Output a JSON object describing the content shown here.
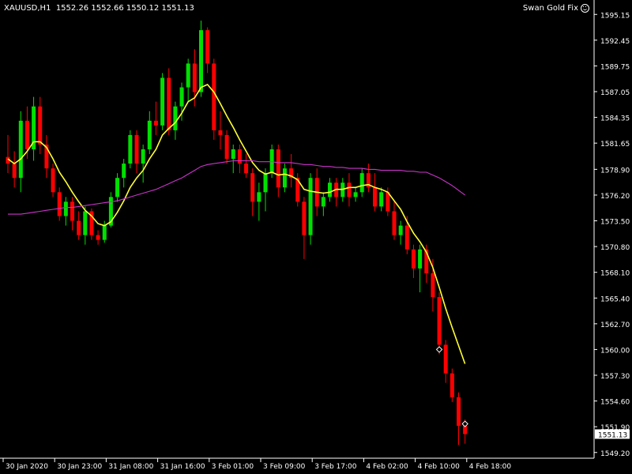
{
  "header": {
    "symbol": "XAUUSD,H1",
    "open": "1552.26",
    "high": "1552.66",
    "low": "1550.12",
    "close": "1551.13"
  },
  "expert": {
    "name": "Swan Gold Fix",
    "icon": "smiley-face-icon"
  },
  "colors": {
    "background": "#000000",
    "bull": "#00e000",
    "bear": "#ff0000",
    "ma_fast": "#ffff33",
    "ma_slow": "#cc33cc",
    "axis": "#ffffff",
    "price_tag_bg": "#ffffff",
    "price_tag_text": "#000000"
  },
  "chart_data": {
    "type": "candlestick",
    "timeframe": "H1",
    "current_price": "1551.13",
    "ylim": [
      1548.6,
      1596.0
    ],
    "y_ticks": [
      "1595.15",
      "1592.45",
      "1589.75",
      "1587.05",
      "1584.35",
      "1581.65",
      "1578.90",
      "1576.20",
      "1573.50",
      "1570.80",
      "1568.10",
      "1565.40",
      "1562.70",
      "1560.00",
      "1557.30",
      "1554.60",
      "1551.90",
      "1549.20"
    ],
    "x_ticks": [
      {
        "index": 0,
        "label": "30 Jan 2020"
      },
      {
        "index": 8,
        "label": "30 Jan 23:00"
      },
      {
        "index": 16,
        "label": "31 Jan 08:00"
      },
      {
        "index": 24,
        "label": "31 Jan 16:00"
      },
      {
        "index": 32,
        "label": "3 Feb 01:00"
      },
      {
        "index": 40,
        "label": "3 Feb 09:00"
      },
      {
        "index": 48,
        "label": "3 Feb 17:00"
      },
      {
        "index": 56,
        "label": "4 Feb 02:00"
      },
      {
        "index": 64,
        "label": "4 Feb 10:00"
      },
      {
        "index": 72,
        "label": "4 Feb 18:00"
      }
    ],
    "candles": [
      [
        1580.2,
        1582.5,
        1578.5,
        1579.5
      ],
      [
        1579.5,
        1580.8,
        1577.0,
        1578.0
      ],
      [
        1578.0,
        1585.0,
        1576.5,
        1584.0
      ],
      [
        1584.0,
        1585.5,
        1580.0,
        1581.0
      ],
      [
        1581.0,
        1586.5,
        1579.8,
        1585.5
      ],
      [
        1585.5,
        1586.5,
        1580.5,
        1581.5
      ],
      [
        1581.5,
        1582.5,
        1578.0,
        1579.0
      ],
      [
        1579.0,
        1579.5,
        1576.0,
        1576.5
      ],
      [
        1576.5,
        1577.0,
        1573.5,
        1574.0
      ],
      [
        1574.0,
        1576.0,
        1573.0,
        1575.5
      ],
      [
        1575.5,
        1576.0,
        1572.5,
        1573.5
      ],
      [
        1573.5,
        1574.5,
        1571.5,
        1572.0
      ],
      [
        1572.0,
        1575.0,
        1571.0,
        1574.5
      ],
      [
        1574.5,
        1574.8,
        1571.5,
        1572.0
      ],
      [
        1572.0,
        1572.5,
        1571.0,
        1571.5
      ],
      [
        1571.5,
        1573.5,
        1571.2,
        1573.0
      ],
      [
        1573.0,
        1576.5,
        1572.8,
        1576.0
      ],
      [
        1576.0,
        1578.5,
        1575.5,
        1578.0
      ],
      [
        1578.0,
        1580.0,
        1577.0,
        1579.5
      ],
      [
        1579.5,
        1583.0,
        1579.0,
        1582.5
      ],
      [
        1582.5,
        1583.0,
        1578.5,
        1579.5
      ],
      [
        1579.5,
        1581.5,
        1577.5,
        1581.0
      ],
      [
        1581.0,
        1585.0,
        1580.5,
        1584.0
      ],
      [
        1584.0,
        1586.0,
        1582.5,
        1583.5
      ],
      [
        1583.5,
        1589.0,
        1583.0,
        1588.5
      ],
      [
        1588.5,
        1589.5,
        1582.5,
        1583.0
      ],
      [
        1583.0,
        1586.0,
        1582.0,
        1585.5
      ],
      [
        1585.5,
        1588.0,
        1584.0,
        1587.5
      ],
      [
        1587.5,
        1590.5,
        1586.0,
        1590.0
      ],
      [
        1590.0,
        1591.5,
        1585.5,
        1587.0
      ],
      [
        1587.0,
        1594.5,
        1586.5,
        1593.5
      ],
      [
        1593.5,
        1593.8,
        1589.0,
        1590.0
      ],
      [
        1590.0,
        1590.5,
        1582.0,
        1583.0
      ],
      [
        1583.0,
        1585.0,
        1581.0,
        1582.5
      ],
      [
        1582.5,
        1583.0,
        1579.5,
        1580.0
      ],
      [
        1580.0,
        1581.5,
        1578.5,
        1581.0
      ],
      [
        1581.0,
        1581.5,
        1578.5,
        1579.5
      ],
      [
        1579.5,
        1580.5,
        1578.0,
        1578.5
      ],
      [
        1578.5,
        1579.0,
        1574.0,
        1575.5
      ],
      [
        1575.5,
        1577.5,
        1573.5,
        1576.5
      ],
      [
        1576.5,
        1579.0,
        1574.5,
        1578.5
      ],
      [
        1578.5,
        1581.5,
        1578.0,
        1581.0
      ],
      [
        1581.0,
        1581.5,
        1576.0,
        1577.0
      ],
      [
        1577.0,
        1579.5,
        1576.5,
        1579.0
      ],
      [
        1579.0,
        1580.5,
        1577.0,
        1578.0
      ],
      [
        1578.0,
        1578.5,
        1575.0,
        1575.5
      ],
      [
        1575.5,
        1576.0,
        1569.5,
        1572.0
      ],
      [
        1572.0,
        1578.5,
        1571.0,
        1578.0
      ],
      [
        1578.0,
        1579.0,
        1574.0,
        1575.0
      ],
      [
        1575.0,
        1576.5,
        1574.0,
        1576.0
      ],
      [
        1576.0,
        1578.0,
        1575.5,
        1577.5
      ],
      [
        1577.5,
        1578.0,
        1575.0,
        1576.0
      ],
      [
        1576.0,
        1578.0,
        1575.5,
        1577.5
      ],
      [
        1577.5,
        1578.5,
        1575.0,
        1576.0
      ],
      [
        1576.0,
        1577.0,
        1575.5,
        1576.5
      ],
      [
        1576.5,
        1579.0,
        1576.0,
        1578.5
      ],
      [
        1578.5,
        1579.5,
        1576.5,
        1577.0
      ],
      [
        1577.0,
        1578.5,
        1574.5,
        1575.0
      ],
      [
        1575.0,
        1577.0,
        1574.5,
        1576.5
      ],
      [
        1576.5,
        1577.0,
        1574.0,
        1574.5
      ],
      [
        1574.5,
        1575.5,
        1571.5,
        1572.0
      ],
      [
        1572.0,
        1573.5,
        1571.0,
        1573.0
      ],
      [
        1573.0,
        1574.0,
        1570.0,
        1570.5
      ],
      [
        1570.5,
        1571.0,
        1567.5,
        1568.5
      ],
      [
        1568.5,
        1571.0,
        1566.0,
        1570.5
      ],
      [
        1570.5,
        1571.0,
        1567.0,
        1568.0
      ],
      [
        1568.0,
        1569.5,
        1564.0,
        1565.5
      ],
      [
        1565.5,
        1566.0,
        1559.5,
        1560.5
      ],
      [
        1560.5,
        1561.0,
        1556.5,
        1557.5
      ],
      [
        1557.5,
        1558.0,
        1554.5,
        1555.0
      ],
      [
        1555.0,
        1555.5,
        1550.0,
        1552.0
      ],
      [
        1552.26,
        1552.66,
        1550.12,
        1551.13
      ]
    ],
    "series": [
      {
        "values": [
          1580.0,
          1579.5,
          1580.0,
          1580.8,
          1581.8,
          1581.8,
          1581.2,
          1580.0,
          1578.6,
          1577.6,
          1576.5,
          1575.5,
          1574.6,
          1574.0,
          1573.2,
          1573.0,
          1573.4,
          1574.4,
          1575.6,
          1577.0,
          1578.0,
          1578.8,
          1580.0,
          1581.0,
          1582.5,
          1583.2,
          1583.8,
          1584.8,
          1586.0,
          1586.4,
          1587.5,
          1587.8,
          1587.0,
          1585.8,
          1584.5,
          1583.3,
          1582.0,
          1580.8,
          1579.6,
          1578.8,
          1578.4,
          1578.6,
          1578.3,
          1578.4,
          1578.2,
          1577.8,
          1576.8,
          1576.6,
          1576.5,
          1576.4,
          1576.5,
          1576.8,
          1576.8,
          1577.0,
          1577.0,
          1577.2,
          1577.3,
          1577.0,
          1576.8,
          1576.5,
          1575.6,
          1574.7,
          1573.4,
          1572.2,
          1571.3,
          1570.2,
          1568.6,
          1566.5,
          1564.3,
          1562.3,
          1560.4,
          1558.5
        ]
      },
      {
        "values": [
          1574.2,
          1574.2,
          1574.2,
          1574.3,
          1574.4,
          1574.5,
          1574.6,
          1574.7,
          1574.8,
          1574.9,
          1574.9,
          1575.0,
          1575.1,
          1575.2,
          1575.3,
          1575.4,
          1575.5,
          1575.6,
          1575.8,
          1576.0,
          1576.2,
          1576.4,
          1576.6,
          1576.8,
          1577.1,
          1577.4,
          1577.7,
          1578.0,
          1578.4,
          1578.8,
          1579.2,
          1579.4,
          1579.5,
          1579.6,
          1579.7,
          1579.8,
          1579.8,
          1579.8,
          1579.8,
          1579.7,
          1579.7,
          1579.7,
          1579.6,
          1579.6,
          1579.6,
          1579.5,
          1579.4,
          1579.4,
          1579.3,
          1579.2,
          1579.2,
          1579.1,
          1579.1,
          1579.0,
          1579.0,
          1579.0,
          1578.9,
          1578.9,
          1578.8,
          1578.8,
          1578.8,
          1578.8,
          1578.7,
          1578.7,
          1578.6,
          1578.6,
          1578.3,
          1578.0,
          1577.6,
          1577.2,
          1576.7,
          1576.2
        ]
      }
    ],
    "markers": [
      {
        "index": 67,
        "price": 1560.0
      },
      {
        "index": 71,
        "price": 1552.2
      }
    ]
  }
}
